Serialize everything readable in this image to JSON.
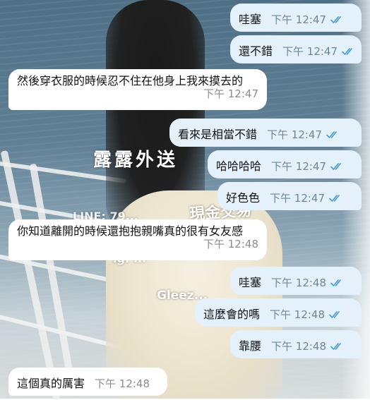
{
  "colors": {
    "outgoing_bubble": "#e4f1fb",
    "incoming_bubble": "#ffffff",
    "read_check": "#4a9fd6",
    "timestamp_out": "#6e8796",
    "timestamp_in": "#8c8c8c"
  },
  "watermarks": [
    "露露外送",
    "現金交易",
    "LINE: 79...",
    "ig: ...",
    "Gleez..."
  ],
  "messages": [
    {
      "direction": "out",
      "text": "哇塞",
      "time": "下午 12:47",
      "status": "read"
    },
    {
      "direction": "out",
      "text": "還不錯",
      "time": "下午 12:47",
      "status": "read"
    },
    {
      "direction": "in",
      "text": "然後穿衣服的時候忍不住在他身上我來摸去的",
      "time": "下午 12:47"
    },
    {
      "direction": "out",
      "text": "看來是相當不錯",
      "time": "下午 12:47",
      "status": "read"
    },
    {
      "direction": "out",
      "text": "哈哈哈哈",
      "time": "下午 12:47",
      "status": "read"
    },
    {
      "direction": "out",
      "text": "好色色",
      "time": "下午 12:47",
      "status": "read"
    },
    {
      "direction": "in",
      "text": "你知道離開的時候還抱抱親嘴真的很有女友感",
      "time": "下午 12:48"
    },
    {
      "direction": "out",
      "text": "哇塞",
      "time": "下午 12:48",
      "status": "read"
    },
    {
      "direction": "out",
      "text": "這麼會的嗎",
      "time": "下午 12:48",
      "status": "read"
    },
    {
      "direction": "out",
      "text": "靠腰",
      "time": "下午 12:48",
      "status": "read"
    },
    {
      "direction": "in",
      "text": "這個真的厲害",
      "time": "下午 12:48"
    }
  ]
}
